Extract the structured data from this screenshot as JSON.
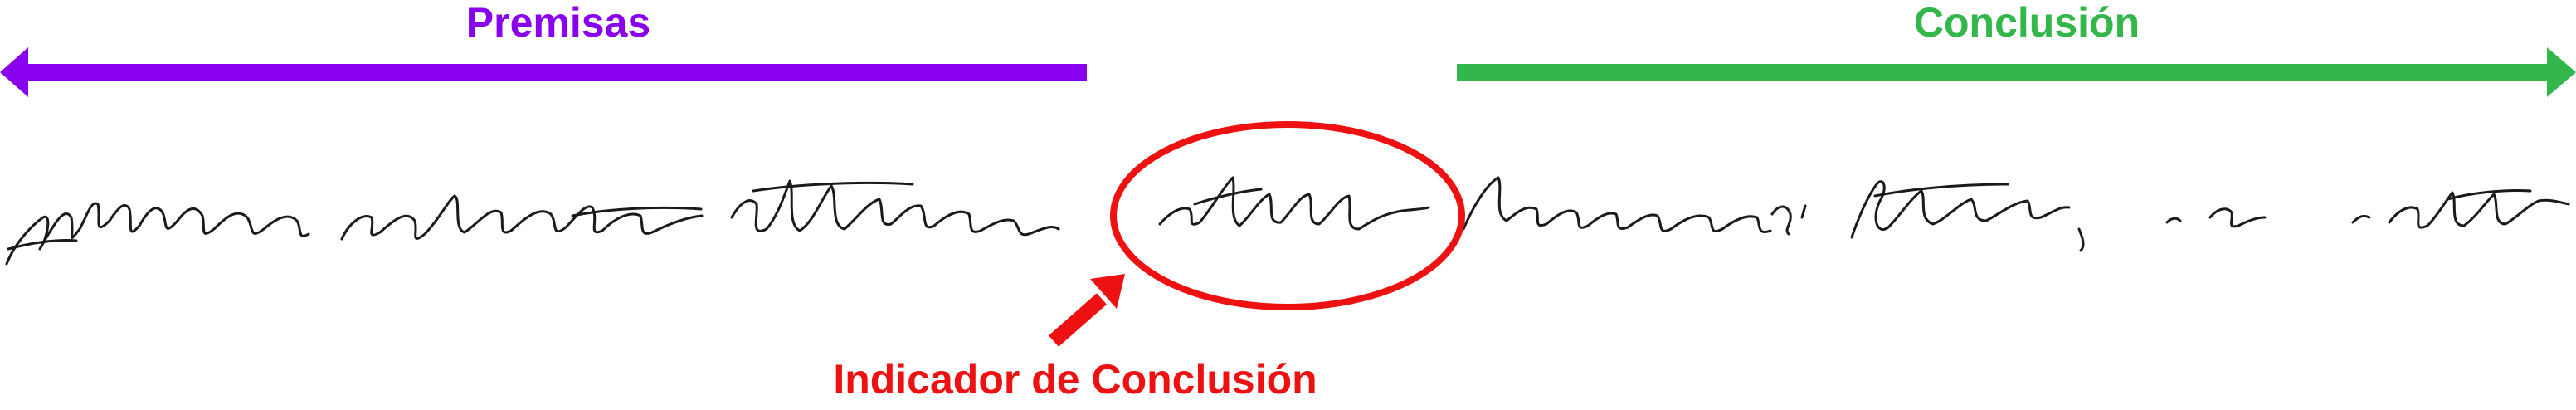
{
  "labels": {
    "premises": "Premisas",
    "conclusion": "Conclusión",
    "conclusion_indicator": "Indicador de Conclusión"
  },
  "colors": {
    "premises": "#8800ee",
    "conclusion": "#33b74a",
    "indicator": "#ee1111",
    "ink": "#1a1a1a"
  },
  "icons": {
    "premises_arrow": "left-arrow",
    "conclusion_arrow": "right-arrow",
    "pointer_arrow": "up-right-arrow",
    "highlight": "ellipse-outline"
  }
}
